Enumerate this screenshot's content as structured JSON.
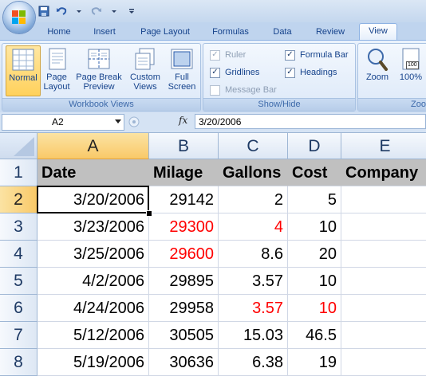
{
  "ribbon": {
    "tabs": [
      "Home",
      "Insert",
      "Page Layout",
      "Formulas",
      "Data",
      "Review",
      "View"
    ],
    "active_tab": "View",
    "workbook_views": {
      "label": "Workbook Views",
      "normal": "Normal",
      "page_layout_1": "Page",
      "page_layout_2": "Layout",
      "page_break_1": "Page Break",
      "page_break_2": "Preview",
      "custom_views_1": "Custom",
      "custom_views_2": "Views",
      "full_screen_1": "Full",
      "full_screen_2": "Screen"
    },
    "show_hide": {
      "label": "Show/Hide",
      "ruler": "Ruler",
      "gridlines": "Gridlines",
      "message_bar": "Message Bar",
      "formula_bar": "Formula Bar",
      "headings": "Headings"
    },
    "zoom": {
      "label": "Zoom",
      "zoom_btn": "Zoom",
      "zoom_100": "100%",
      "zoom_100_badge": "100"
    },
    "check": "✓"
  },
  "formula_bar": {
    "name_box": "A2",
    "fx": "fx",
    "value": "3/20/2006"
  },
  "grid": {
    "columns": [
      "A",
      "B",
      "C",
      "D",
      "E"
    ],
    "rows": [
      "1",
      "2",
      "3",
      "4",
      "5",
      "6",
      "7",
      "8"
    ],
    "header": [
      "Date",
      "Milage",
      "Gallons",
      "Cost",
      "Company"
    ],
    "data": [
      [
        "3/20/2006",
        "29142",
        "2",
        "5"
      ],
      [
        "3/23/2006",
        "29300",
        "4",
        "10"
      ],
      [
        "3/25/2006",
        "29600",
        "8.6",
        "20"
      ],
      [
        "4/2/2006",
        "29895",
        "3.57",
        "10"
      ],
      [
        "4/24/2006",
        "29958",
        "3.57",
        "10"
      ],
      [
        "5/12/2006",
        "30505",
        "15.03",
        "46.5"
      ],
      [
        "5/19/2006",
        "30636",
        "6.38",
        "19"
      ]
    ]
  },
  "colors": {
    "accent": "#15428b",
    "red_value": "#ff0000",
    "selected_header": "#f9c968"
  }
}
